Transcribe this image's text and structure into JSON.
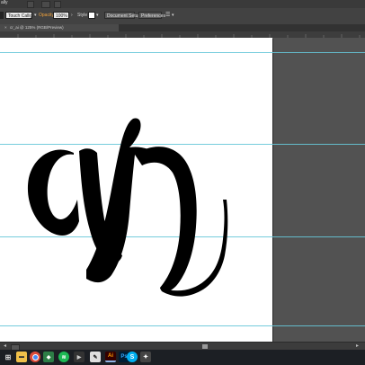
{
  "topbar": {
    "app_label": "ally"
  },
  "control_bar": {
    "brush_label": "Touch Callig...",
    "opacity_label": "Opacity",
    "opacity_value": "100%",
    "style_label": "Style",
    "document_setup_label": "Document Setup",
    "preferences_label": "Preferences"
  },
  "document_tab": {
    "title": "cr_ai @ 125% (RGB/Preview)"
  },
  "colors": {
    "guide": "#66c7d8",
    "accent": "#f2a33b",
    "ink": "#000000"
  },
  "artwork": {
    "lettering": "ar"
  },
  "taskbar": {
    "icons": [
      "windows-icon",
      "file-explorer-icon",
      "chrome-icon",
      "store-icon",
      "spotify-icon",
      "media-icon",
      "app-icon",
      "illustrator-icon",
      "photoshop-icon",
      "skype-icon",
      "browser-icon"
    ]
  }
}
